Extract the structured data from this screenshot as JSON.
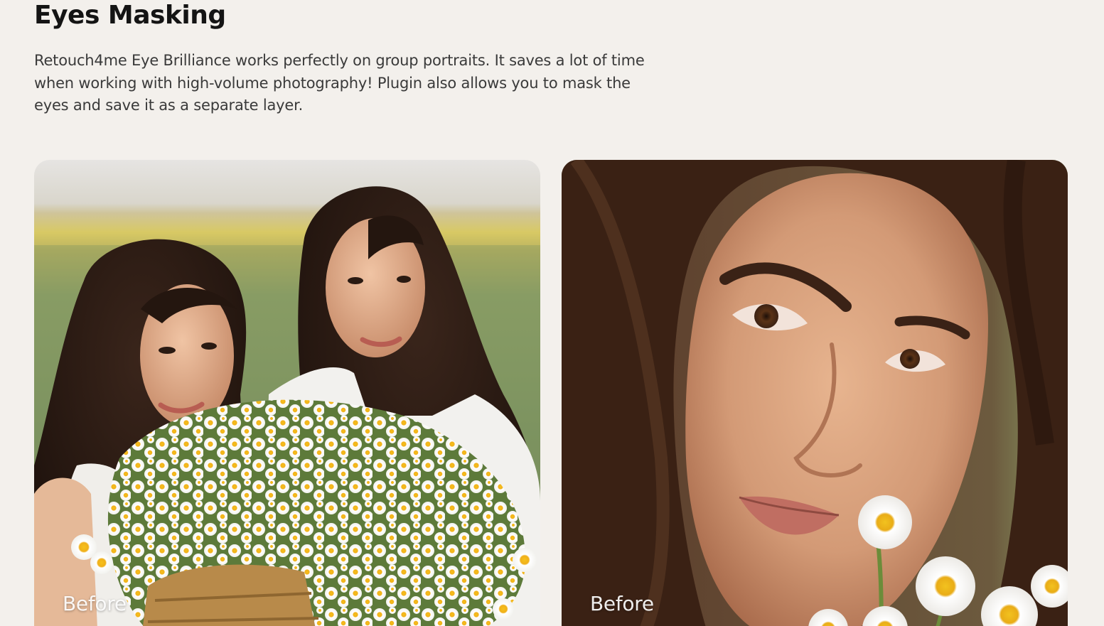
{
  "section": {
    "title": "Eyes Masking",
    "description": "Retouch4me Eye Brilliance works perfectly on group portraits. It saves a lot of time when working with high-volume photography! Plugin also allows you to mask the eyes and save it as a separate layer."
  },
  "comparisons": [
    {
      "label": "Before"
    },
    {
      "label": "Before"
    }
  ]
}
